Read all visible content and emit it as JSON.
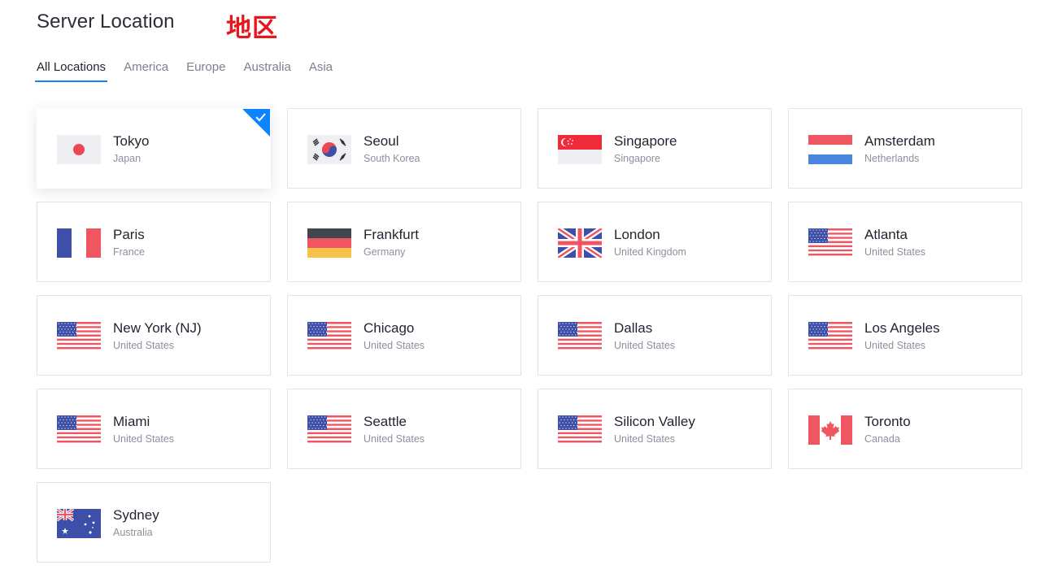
{
  "header": {
    "title": "Server Location",
    "annotation": "地区"
  },
  "tabs": [
    {
      "label": "All Locations",
      "active": true
    },
    {
      "label": "America",
      "active": false
    },
    {
      "label": "Europe",
      "active": false
    },
    {
      "label": "Australia",
      "active": false
    },
    {
      "label": "Asia",
      "active": false
    }
  ],
  "colors": {
    "accent": "#0a84ff",
    "annotation": "#e8151b"
  },
  "locations": [
    {
      "city": "Tokyo",
      "country": "Japan",
      "flag": "japan-flag-icon",
      "selected": true
    },
    {
      "city": "Seoul",
      "country": "South Korea",
      "flag": "south-korea-flag-icon",
      "selected": false
    },
    {
      "city": "Singapore",
      "country": "Singapore",
      "flag": "singapore-flag-icon",
      "selected": false
    },
    {
      "city": "Amsterdam",
      "country": "Netherlands",
      "flag": "netherlands-flag-icon",
      "selected": false
    },
    {
      "city": "Paris",
      "country": "France",
      "flag": "france-flag-icon",
      "selected": false
    },
    {
      "city": "Frankfurt",
      "country": "Germany",
      "flag": "germany-flag-icon",
      "selected": false
    },
    {
      "city": "London",
      "country": "United Kingdom",
      "flag": "uk-flag-icon",
      "selected": false
    },
    {
      "city": "Atlanta",
      "country": "United States",
      "flag": "usa-flag-icon",
      "selected": false
    },
    {
      "city": "New York (NJ)",
      "country": "United States",
      "flag": "usa-flag-icon",
      "selected": false
    },
    {
      "city": "Chicago",
      "country": "United States",
      "flag": "usa-flag-icon",
      "selected": false
    },
    {
      "city": "Dallas",
      "country": "United States",
      "flag": "usa-flag-icon",
      "selected": false
    },
    {
      "city": "Los Angeles",
      "country": "United States",
      "flag": "usa-flag-icon",
      "selected": false
    },
    {
      "city": "Miami",
      "country": "United States",
      "flag": "usa-flag-icon",
      "selected": false
    },
    {
      "city": "Seattle",
      "country": "United States",
      "flag": "usa-flag-icon",
      "selected": false
    },
    {
      "city": "Silicon Valley",
      "country": "United States",
      "flag": "usa-flag-icon",
      "selected": false
    },
    {
      "city": "Toronto",
      "country": "Canada",
      "flag": "canada-flag-icon",
      "selected": false
    },
    {
      "city": "Sydney",
      "country": "Australia",
      "flag": "australia-flag-icon",
      "selected": false
    }
  ]
}
